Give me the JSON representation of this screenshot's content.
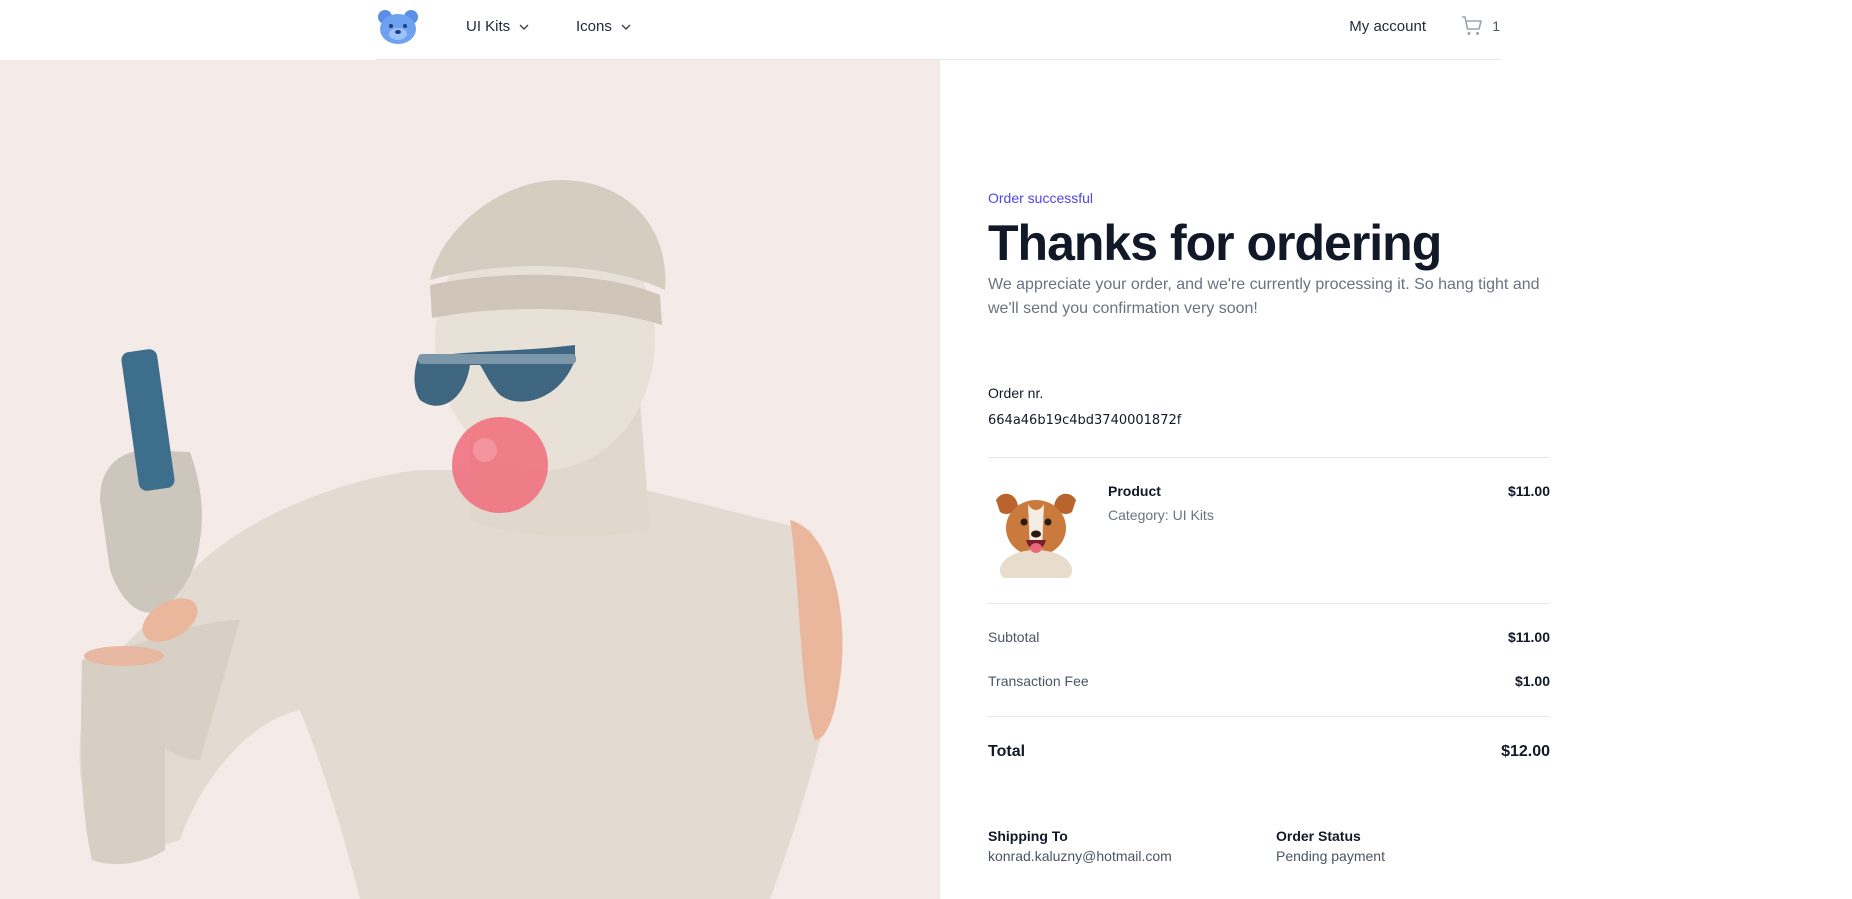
{
  "header": {
    "logo_icon": "bear-logo-icon",
    "nav": [
      {
        "label": "UI Kits",
        "icon": "chevron-down-icon"
      },
      {
        "label": "Icons",
        "icon": "chevron-down-icon"
      }
    ],
    "my_account": "My account",
    "cart_icon": "shopping-cart-icon",
    "cart_count": "1"
  },
  "hero": {
    "image": "statue-with-sunglasses-and-bubblegum"
  },
  "order": {
    "eyebrow": "Order successful",
    "title": "Thanks for ordering",
    "subtitle": "We appreciate your order, and we're currently processing it. So hang tight and we'll send you confirmation very soon!",
    "number_label": "Order nr.",
    "number": "664a46b19c4bd3740001872f",
    "item": {
      "name": "Product",
      "category": "Category: UI Kits",
      "price": "$11.00",
      "image": "dog-photo"
    },
    "subtotal_label": "Subtotal",
    "subtotal": "$11.00",
    "fee_label": "Transaction Fee",
    "fee": "$1.00",
    "total_label": "Total",
    "total": "$12.00",
    "shipping_label": "Shipping To",
    "shipping": "konrad.kaluzny@hotmail.com",
    "status_label": "Order Status",
    "status": "Pending payment"
  },
  "colors": {
    "accent": "#4f46e5",
    "hero_bg": "#f4ebe9",
    "text": "#111827",
    "muted": "#6b7280"
  }
}
